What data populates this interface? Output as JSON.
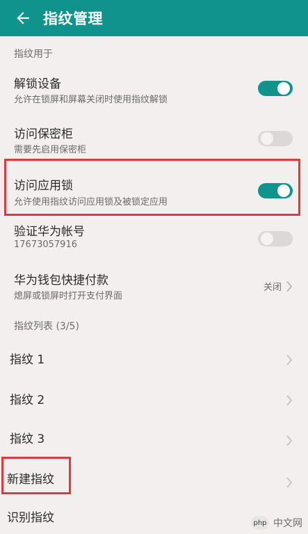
{
  "header": {
    "title": "指纹管理"
  },
  "sections": [
    {
      "label": "指纹用于"
    },
    {
      "label": "指纹列表 (3/5)"
    }
  ],
  "settings": [
    {
      "title": "解锁设备",
      "subtitle": "允许在锁屏和屏幕关闭时使用指纹解锁",
      "toggle": true
    },
    {
      "title": "访问保密柜",
      "subtitle": "需要先启用保密柜",
      "toggle": false
    },
    {
      "title": "访问应用锁",
      "subtitle": "允许使用指纹访问应用锁及被锁定应用",
      "toggle": true
    },
    {
      "title": "验证华为帐号",
      "subtitle": "17673057916",
      "toggle": false
    },
    {
      "title": "华为钱包快捷付款",
      "subtitle": "熄屏或锁屏时打开支付界面",
      "status": "关闭"
    }
  ],
  "fingerprints": [
    {
      "label": "指纹 1"
    },
    {
      "label": "指纹 2"
    },
    {
      "label": "指纹 3"
    },
    {
      "label": "新建指纹"
    },
    {
      "label": "识别指纹"
    }
  ],
  "watermark": {
    "logo_text": "php",
    "site_text": "中文网"
  },
  "colors": {
    "accent": "#0f938c",
    "highlight_box": "#dc3b3b",
    "background": "#f2efee"
  }
}
